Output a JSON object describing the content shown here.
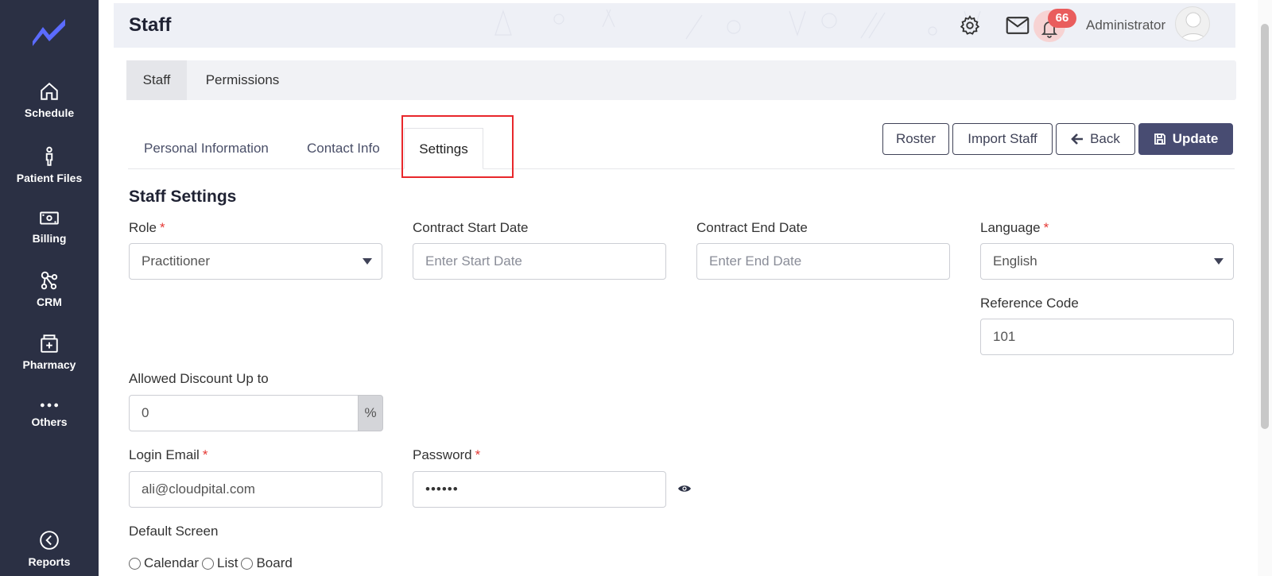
{
  "sidebar": {
    "items": [
      {
        "label": "Schedule",
        "icon": "home-icon"
      },
      {
        "label": "Patient Files",
        "icon": "person-icon"
      },
      {
        "label": "Billing",
        "icon": "money-icon"
      },
      {
        "label": "CRM",
        "icon": "network-icon"
      },
      {
        "label": "Pharmacy",
        "icon": "pharmacy-icon"
      },
      {
        "label": "Others",
        "icon": "more-icon"
      },
      {
        "label": "Reports",
        "icon": "chevron-left-icon"
      }
    ]
  },
  "header": {
    "title": "Staff",
    "notification_count": "66",
    "user_name": "Administrator"
  },
  "top_tabs": [
    {
      "label": "Staff",
      "active": true
    },
    {
      "label": "Permissions",
      "active": false
    }
  ],
  "sub_tabs": [
    {
      "label": "Personal Information"
    },
    {
      "label": "Contact Info"
    },
    {
      "label": "Settings",
      "active": true
    }
  ],
  "actions": {
    "roster": "Roster",
    "import_staff": "Import Staff",
    "back": "Back",
    "update": "Update"
  },
  "form": {
    "section_title": "Staff Settings",
    "role": {
      "label": "Role",
      "value": "Practitioner"
    },
    "contract_start": {
      "label": "Contract Start Date",
      "placeholder": "Enter Start Date"
    },
    "contract_end": {
      "label": "Contract End Date",
      "placeholder": "Enter End Date"
    },
    "language": {
      "label": "Language",
      "value": "English"
    },
    "reference_code": {
      "label": "Reference Code",
      "value": "101"
    },
    "discount": {
      "label": "Allowed Discount Up to",
      "value": "0",
      "suffix": "%"
    },
    "login_email": {
      "label": "Login Email",
      "value": "ali@cloudpital.com"
    },
    "password": {
      "label": "Password",
      "value": "••••••"
    },
    "default_screen": {
      "label": "Default Screen",
      "options": [
        "Calendar",
        "List",
        "Board"
      ]
    },
    "required_marker": "*"
  },
  "colors": {
    "sidebar_bg": "#2b3044",
    "primary": "#484c72",
    "badge": "#e95d5d",
    "highlight": "#e8272b"
  }
}
